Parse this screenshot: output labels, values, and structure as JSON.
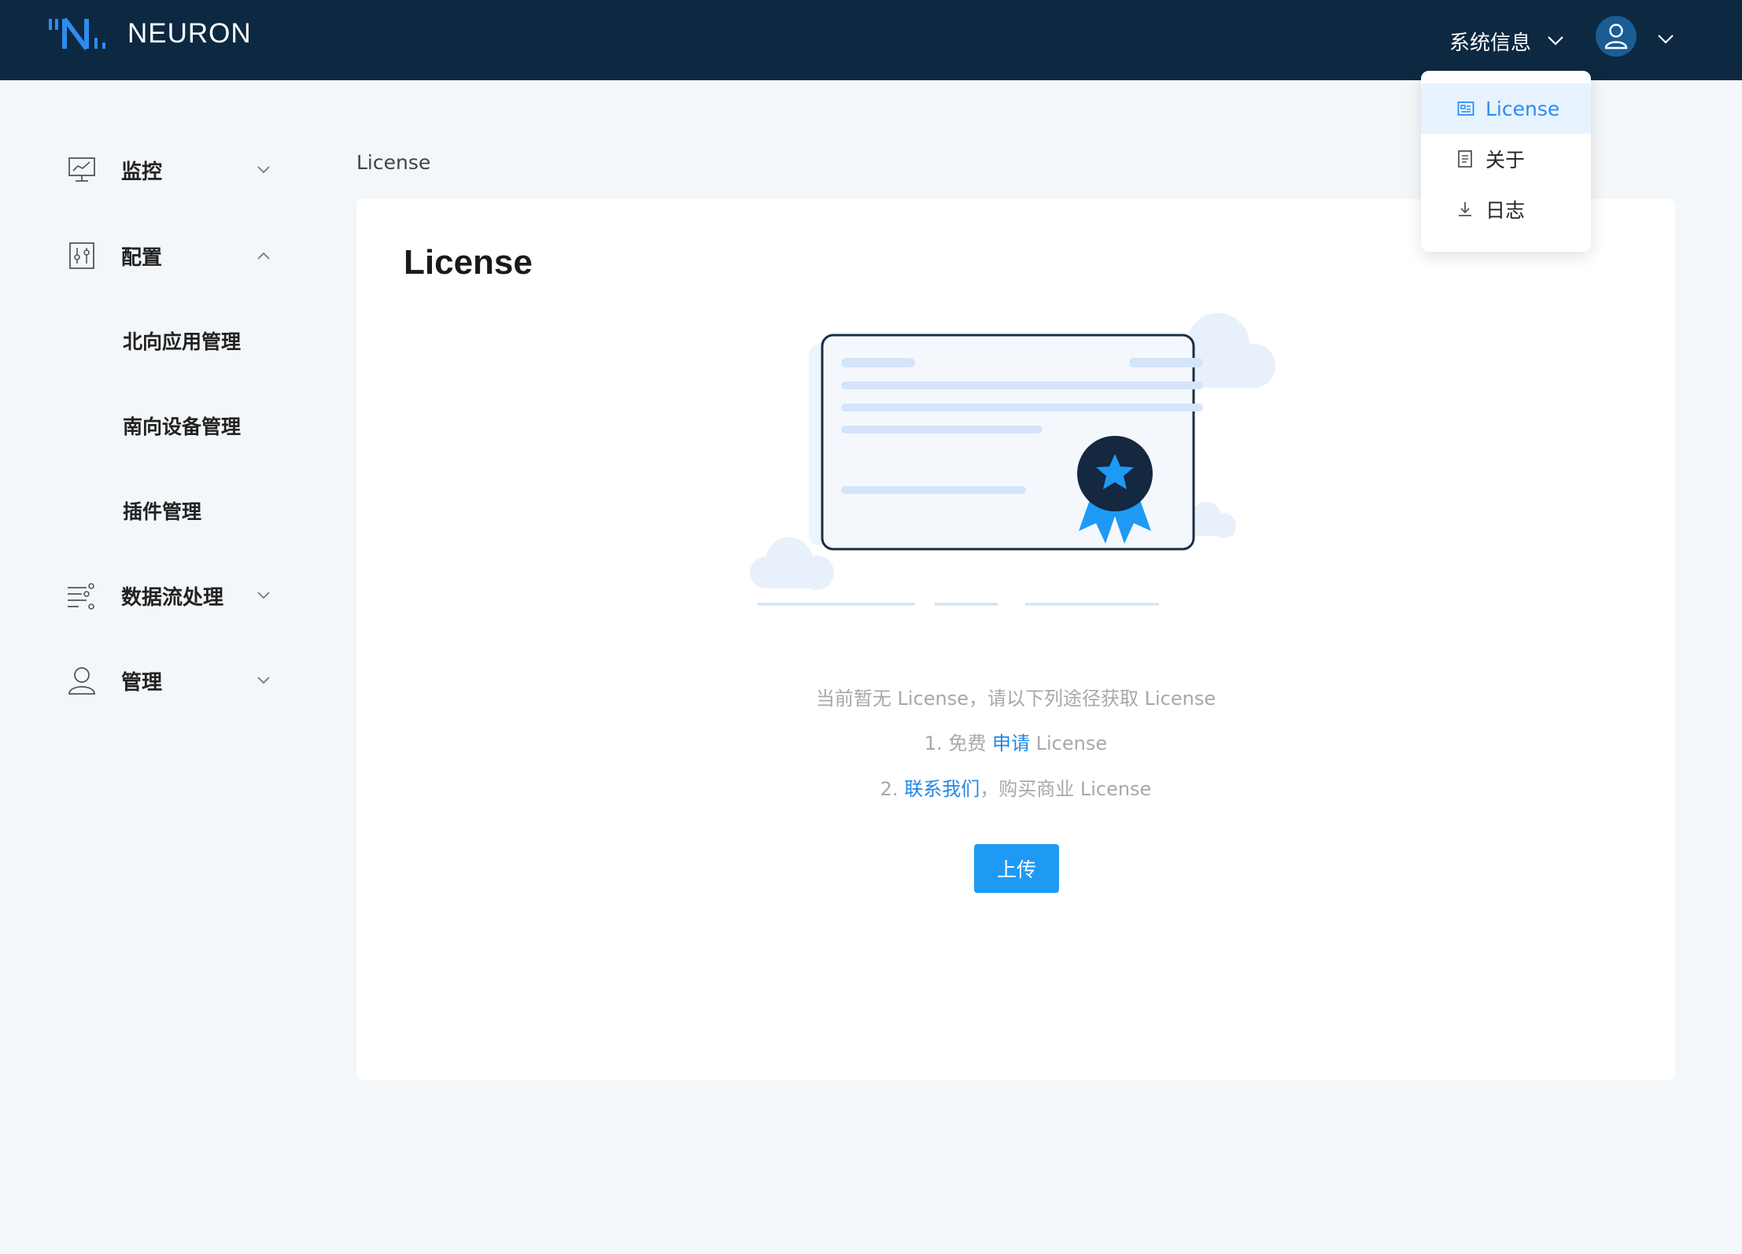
{
  "header": {
    "app_name": "NEURON",
    "sysinfo_label": "系统信息"
  },
  "dropdown": {
    "items": [
      {
        "label": "License",
        "icon": "license-icon",
        "active": true
      },
      {
        "label": "关于",
        "icon": "document-icon",
        "active": false
      },
      {
        "label": "日志",
        "icon": "download-icon",
        "active": false
      }
    ]
  },
  "sidebar": {
    "items": [
      {
        "label": "监控",
        "icon": "monitor-icon",
        "expanded": false
      },
      {
        "label": "配置",
        "icon": "config-icon",
        "expanded": true
      },
      {
        "label": "数据流处理",
        "icon": "dataflow-icon",
        "expanded": false
      },
      {
        "label": "管理",
        "icon": "user-icon",
        "expanded": false
      }
    ],
    "config_sub": [
      "北向应用管理",
      "南向设备管理",
      "插件管理"
    ]
  },
  "breadcrumb": "License",
  "main": {
    "title": "License",
    "line1": "当前暂无 License，请以下列途径获取 License",
    "line2_prefix": "1. 免费 ",
    "line2_link": "申请",
    "line2_suffix": " License",
    "line3_prefix": "2. ",
    "line3_link": "联系我们",
    "line3_suffix": "，购买商业 License",
    "upload_label": "上传"
  },
  "colors": {
    "header_bg": "#0d2841",
    "accent": "#1e9af5",
    "link": "#1e88e5",
    "page_bg": "#f3f7fa"
  }
}
